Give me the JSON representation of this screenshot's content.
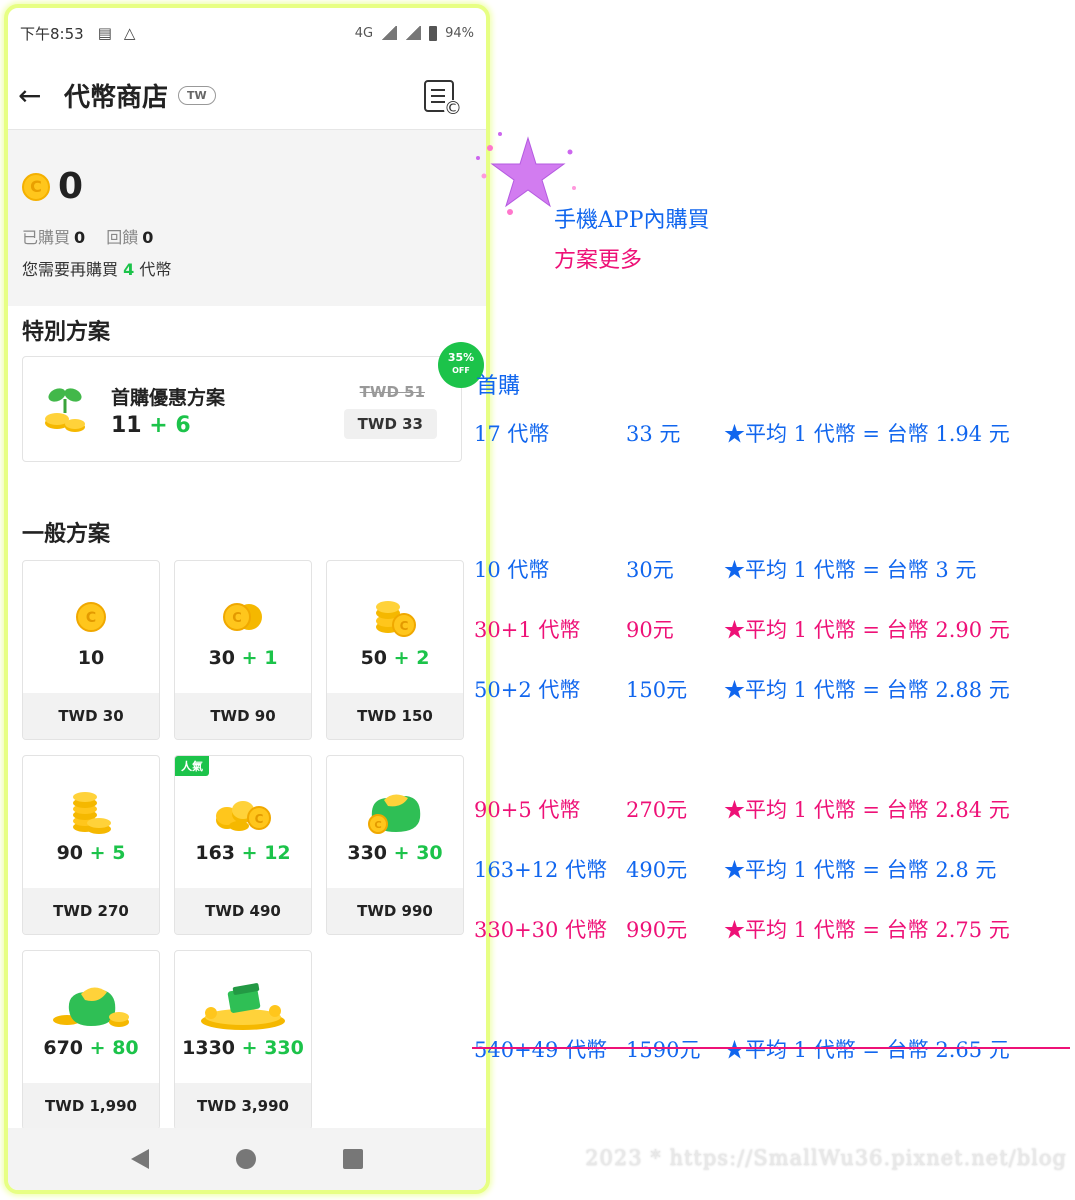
{
  "status_bar": {
    "time": "下午8:53",
    "network": "4G",
    "battery": "94%"
  },
  "app_bar": {
    "title": "代幣商店",
    "region": "TW"
  },
  "balance": {
    "value": "0",
    "purchased_label": "已購買",
    "purchased_value": "0",
    "gifted_label": "回饋",
    "gifted_value": "0",
    "need_prefix": "您需要再購買",
    "need_value": "4",
    "need_suffix": "代幣"
  },
  "special": {
    "section_title": "特別方案",
    "name": "首購優惠方案",
    "base": "11",
    "bonus": "+ 6",
    "old_price": "TWD 51",
    "price": "TWD 33",
    "discount_pct": "35%",
    "discount_word": "OFF"
  },
  "general": {
    "section_title": "一般方案",
    "packs": [
      {
        "base": "10",
        "bonus": "",
        "price": "TWD 30",
        "icon": "single-coin-icon"
      },
      {
        "base": "30",
        "bonus": "+ 1",
        "price": "TWD 90",
        "icon": "two-coins-icon"
      },
      {
        "base": "50",
        "bonus": "+ 2",
        "price": "TWD 150",
        "icon": "coin-stack-icon"
      },
      {
        "base": "90",
        "bonus": "+ 5",
        "price": "TWD 270",
        "icon": "coin-tower-icon"
      },
      {
        "base": "163",
        "bonus": "+ 12",
        "price": "TWD 490",
        "icon": "coin-pile-icon",
        "badge": "人氣"
      },
      {
        "base": "330",
        "bonus": "+ 30",
        "price": "TWD 990",
        "icon": "coin-bag-icon"
      },
      {
        "base": "670",
        "bonus": "+ 80",
        "price": "TWD 1,990",
        "icon": "coin-bag-large-icon"
      },
      {
        "base": "1330",
        "bonus": "+ 330",
        "price": "TWD 3,990",
        "icon": "treasure-pile-icon"
      }
    ]
  },
  "annotations": {
    "intro_line1": "手機APP內購買",
    "intro_line2": "方案更多",
    "first_label": "首購",
    "rows": [
      {
        "tokens": "17 代幣",
        "price": "33 元",
        "avg": "★平均 1 代幣 = 台幣 1.94 元",
        "color": "#1166ee"
      },
      {
        "tokens": "10 代幣",
        "price": "30元",
        "avg": "★平均 1 代幣 = 台幣 3 元",
        "color": "#1166ee"
      },
      {
        "tokens": "30+1 代幣",
        "price": "90元",
        "avg": "★平均 1 代幣 = 台幣 2.90 元",
        "color": "#ee1177"
      },
      {
        "tokens": "50+2 代幣",
        "price": "150元",
        "avg": "★平均 1 代幣 = 台幣 2.88 元",
        "color": "#1166ee"
      },
      {
        "tokens": "90+5 代幣",
        "price": "270元",
        "avg": "★平均 1 代幣 = 台幣 2.84 元",
        "color": "#ee1177"
      },
      {
        "tokens": "163+12 代幣",
        "price": "490元",
        "avg": "★平均 1 代幣 = 台幣 2.8 元",
        "color": "#1166ee"
      },
      {
        "tokens": "330+30 代幣",
        "price": "990元",
        "avg": "★平均 1 代幣 = 台幣 2.75 元",
        "color": "#ee1177"
      },
      {
        "tokens": "540+49 代幣",
        "price": "1590元",
        "avg": "★平均 1 代幣 = 台幣 2.65 元",
        "color": "#1166ee"
      }
    ],
    "watermark": "2023 * https://SmallWu36.pixnet.net/blog"
  },
  "colors": {
    "accent_green": "#1cc34a",
    "coin_gold": "#ffc61c",
    "frame_highlight": "#e7ff84"
  }
}
